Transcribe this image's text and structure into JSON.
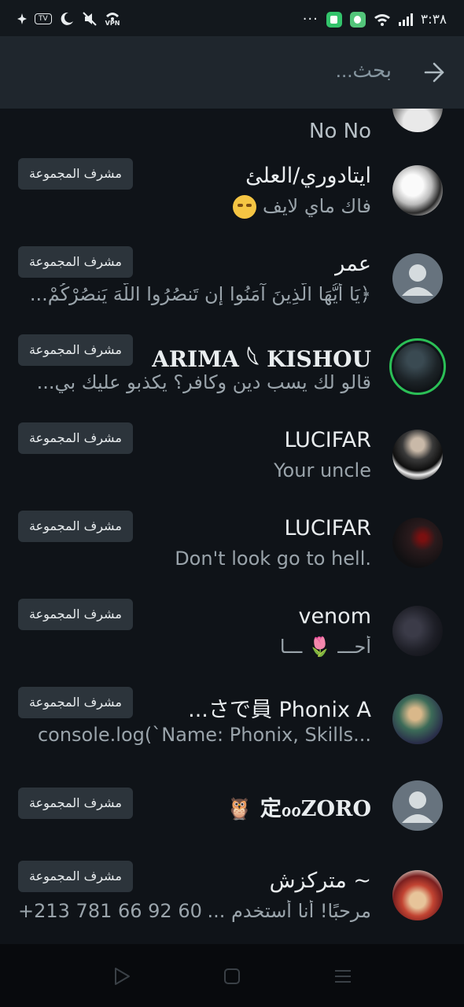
{
  "status_bar": {
    "time": "٣:٣٨",
    "tv_label": "TV",
    "vpn_label": "VPN",
    "overflow": "···"
  },
  "search": {
    "placeholder": "بحث...",
    "value": ""
  },
  "list": {
    "partial_row": {
      "subtitle": "No No"
    },
    "rows": [
      {
        "name": "ايتادوري/العلئ",
        "subtitle": "فاك ماي لايف",
        "badge": "مشرف المجموعة",
        "avatar": "anime-bw-avatar"
      },
      {
        "name": "عمر",
        "subtitle": "﴿يَا أَيُّهَا الَّذِينَ آمَنُوا إِن تَنصُرُوا اللَّهَ يَنصُرْكُمْ...",
        "badge": "مشرف المجموعة",
        "avatar": "default-avatar"
      },
      {
        "name": "ARIMA 𓆩 KISHOU",
        "subtitle": "قالو لك يسب دين وكافر؟ يكذبو عليك بي...",
        "badge": "مشرف المجموعة",
        "avatar": "dark-portrait-avatar"
      },
      {
        "name": "LUCIFAR",
        "subtitle": "Your uncle",
        "badge": "مشرف المجموعة",
        "avatar": "suit-portrait-avatar"
      },
      {
        "name": "LUCIFAR",
        "subtitle": "Don't look go to hell.",
        "badge": "مشرف المجموعة",
        "avatar": "red-eyes-avatar"
      },
      {
        "name": "venom",
        "subtitle": "أحـــ 🌷 ـــا",
        "badge": "مشرف المجموعة",
        "avatar": "dark-anime-avatar"
      },
      {
        "name": "さで員 Phonix A...",
        "subtitle": "console.log(`Name: Phonix, Skills...",
        "badge": "مشرف المجموعة",
        "avatar": "green-anime-avatar"
      },
      {
        "name": "定ℴℴZORO 🦉",
        "subtitle": "",
        "badge": "مشرف المجموعة",
        "avatar": "default-avatar"
      },
      {
        "name": "~ متركزش",
        "subtitle": "مرحبًا! أنا أستخدم ...",
        "badge": "مشرف المجموعة",
        "phone": "+213 781 66 92 60",
        "avatar": "red-hat-anime-avatar"
      }
    ]
  },
  "colors": {
    "background": "#0f1318",
    "header": "#1f262d",
    "badge_bg": "#2c343b",
    "online_ring": "#2bbf56",
    "muted_text": "#9aa4ab"
  }
}
